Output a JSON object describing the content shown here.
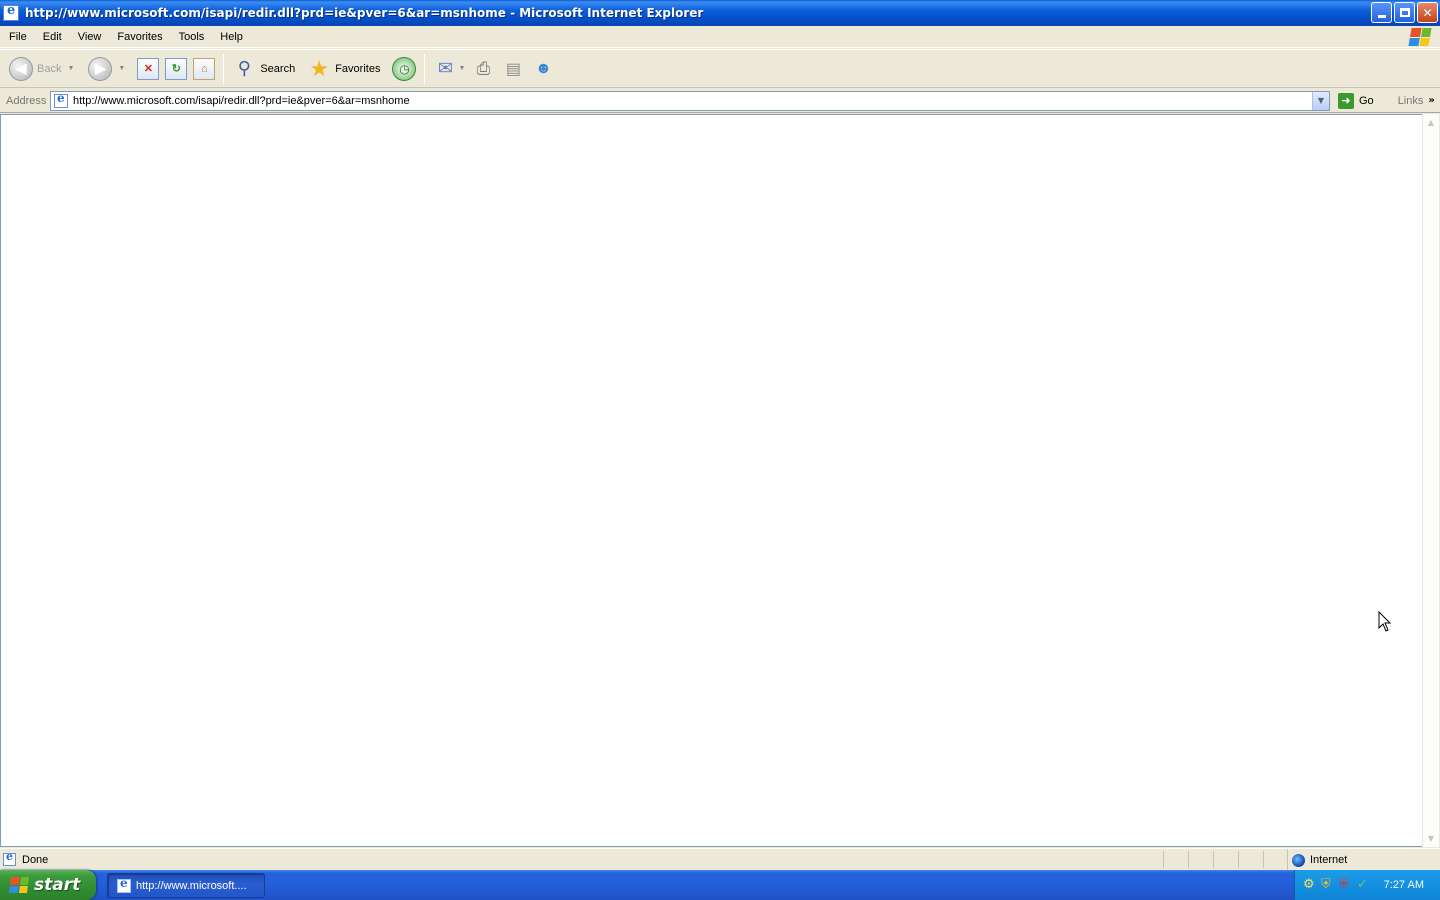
{
  "window": {
    "title": "http://www.microsoft.com/isapi/redir.dll?prd=ie&pver=6&ar=msnhome - Microsoft Internet Explorer"
  },
  "menu": {
    "items": [
      "File",
      "Edit",
      "View",
      "Favorites",
      "Tools",
      "Help"
    ]
  },
  "toolbar": {
    "back_label": "Back",
    "search_label": "Search",
    "favorites_label": "Favorites"
  },
  "address": {
    "label": "Address",
    "url": "http://www.microsoft.com/isapi/redir.dll?prd=ie&pver=6&ar=msnhome",
    "go_label": "Go",
    "links_label": "Links"
  },
  "status": {
    "text": "Done",
    "zone": "Internet"
  },
  "taskbar": {
    "start_label": "start",
    "task_label": "http://www.microsoft....",
    "clock": "7:27 AM"
  },
  "colors": {
    "titlebar": "#0a5fd8",
    "chrome": "#ece9d8",
    "taskbar": "#245edb",
    "start": "#3d9a3d",
    "tray": "#1591e0"
  },
  "icons": {
    "toolbar": [
      "back-icon",
      "forward-icon",
      "stop-icon",
      "refresh-icon",
      "home-icon",
      "search-icon",
      "favorites-star-icon",
      "history-icon",
      "mail-icon",
      "print-icon",
      "edit-icon",
      "messenger-icon"
    ],
    "tray": [
      "network-icon",
      "security-shield-icon",
      "antivirus-icon",
      "update-icon"
    ]
  }
}
